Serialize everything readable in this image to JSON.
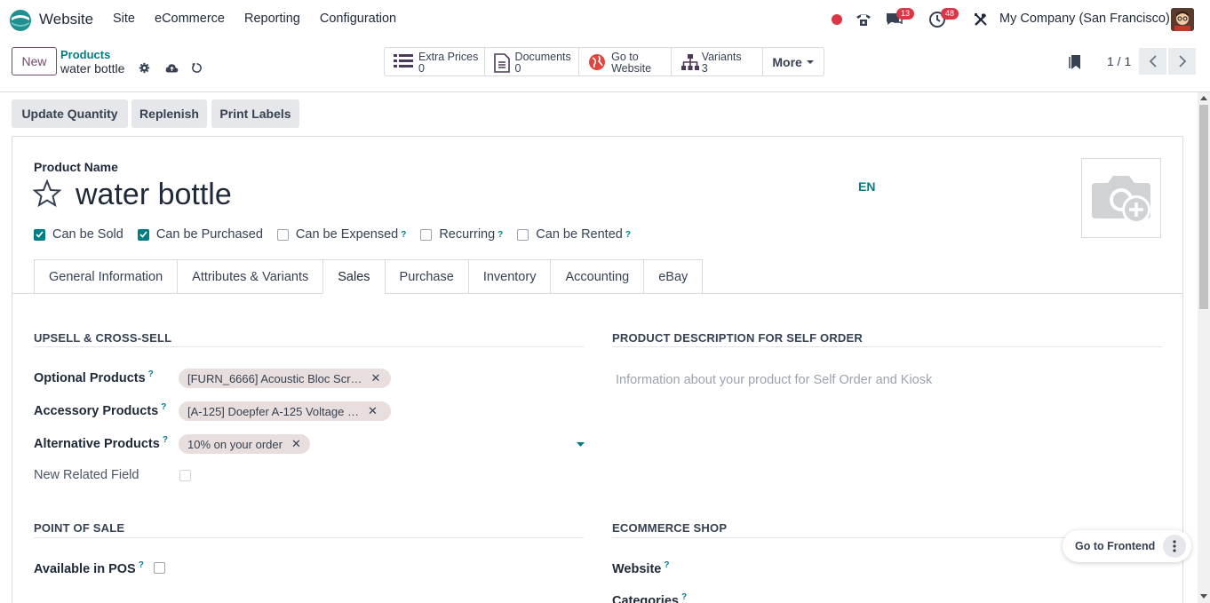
{
  "navbar": {
    "app_name": "Website",
    "menu": [
      "Site",
      "eCommerce",
      "Reporting",
      "Configuration"
    ],
    "chat_count": "13",
    "activity_count": "48",
    "company": "My Company (San Francisco)",
    "accent": "#714b67",
    "teal": "#017e84"
  },
  "control": {
    "new_label": "New",
    "breadcrumb_parent": "Products",
    "breadcrumb_current": "water bottle",
    "smart_buttons": [
      {
        "label": "Extra Prices",
        "value": "0",
        "icon": "list-icon"
      },
      {
        "label": "Documents",
        "value": "0",
        "icon": "document-icon"
      },
      {
        "label": "Go to",
        "value": "Website",
        "icon": "globe-icon"
      },
      {
        "label": "Variants",
        "value": "3",
        "icon": "sitemap-icon"
      }
    ],
    "more_label": "More",
    "pager": "1 / 1"
  },
  "header_buttons": [
    "Update Quantity",
    "Replenish",
    "Print Labels"
  ],
  "product": {
    "name_label": "Product Name",
    "name": "water bottle",
    "lang": "EN",
    "options": [
      {
        "label": "Can be Sold",
        "checked": true,
        "help": false
      },
      {
        "label": "Can be Purchased",
        "checked": true,
        "help": false
      },
      {
        "label": "Can be Expensed",
        "checked": false,
        "help": true
      },
      {
        "label": "Recurring",
        "checked": false,
        "help": true
      },
      {
        "label": "Can be Rented",
        "checked": false,
        "help": true
      }
    ]
  },
  "tabs": [
    "General Information",
    "Attributes & Variants",
    "Sales",
    "Purchase",
    "Inventory",
    "Accounting",
    "eBay"
  ],
  "active_tab": "Sales",
  "sales": {
    "upsell_title": "UPSELL & CROSS-SELL",
    "optional_label": "Optional Products",
    "optional_tag": "[FURN_6666] Acoustic Bloc Scr…",
    "accessory_label": "Accessory Products",
    "accessory_tag": "[A-125] Doepfer A-125 Voltage …",
    "alternative_label": "Alternative Products",
    "alternative_tag": "10% on your order",
    "related_label": "New Related Field",
    "self_order_title": "PRODUCT DESCRIPTION FOR SELF ORDER",
    "self_order_placeholder": "Information about your product for Self Order and Kiosk",
    "pos_title": "POINT OF SALE",
    "pos_label": "Available in POS",
    "shop_title": "ECOMMERCE SHOP",
    "website_label": "Website",
    "categories_label": "Categories"
  },
  "fab": {
    "label": "Go to Frontend"
  },
  "help_mark": "?"
}
